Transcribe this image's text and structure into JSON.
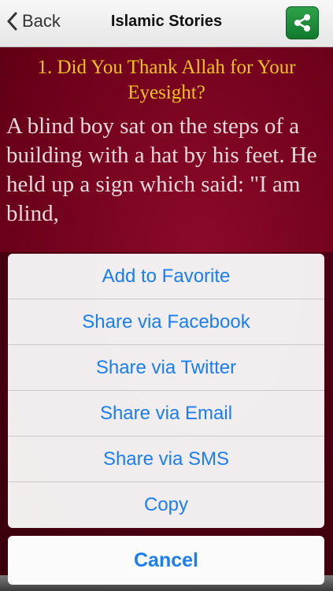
{
  "navbar": {
    "back_label": "Back",
    "title": "Islamic Stories",
    "share_icon": "share-icon"
  },
  "story": {
    "title": "1. Did You Thank Allah for Your Eyesight?",
    "body": "A blind boy sat on the steps of a building with a hat by his feet. He held up a sign which said: \"I am blind,"
  },
  "action_sheet": {
    "options": [
      {
        "label": "Add to Favorite"
      },
      {
        "label": "Share via Facebook"
      },
      {
        "label": "Share via Twitter"
      },
      {
        "label": "Share via Email"
      },
      {
        "label": "Share via SMS"
      },
      {
        "label": "Copy"
      }
    ],
    "cancel_label": "Cancel"
  },
  "colors": {
    "accent": "#1a7ef2",
    "title_gold": "#f0c419",
    "background": "#6e0019",
    "share_green": "#1f8c3b"
  }
}
